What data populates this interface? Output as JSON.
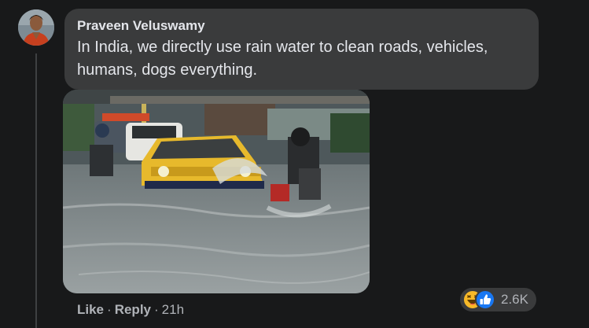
{
  "comment": {
    "author": "Praveen Veluswamy",
    "text": "In India, we directly use rain water to clean roads, vehicles, humans, dogs everything."
  },
  "actions": {
    "like_label": "Like",
    "reply_label": "Reply",
    "separator": "·",
    "timestamp": "21h"
  },
  "reactions": {
    "icons": [
      "haha-icon",
      "like-icon"
    ],
    "count": "2.6K"
  },
  "colors": {
    "background": "#18191a",
    "bubble": "#3a3b3c",
    "text_primary": "#e4e6eb",
    "text_secondary": "#b0b3b8",
    "like_blue": "#1877f2",
    "haha_yellow": "#f7b928"
  }
}
